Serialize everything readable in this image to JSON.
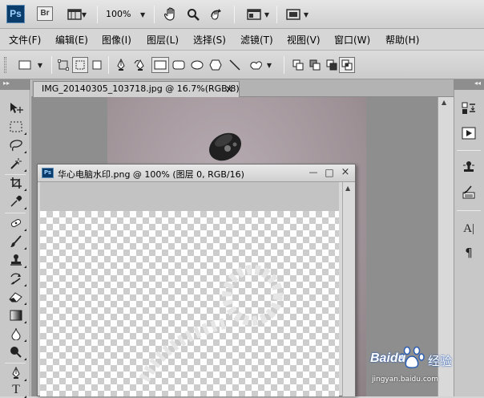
{
  "appbar": {
    "ps_logo": "Ps",
    "br_logo": "Br",
    "zoom": "100%",
    "icons": [
      "view-extras-icon",
      "zoom-level-dropdown",
      "hand-tool-icon",
      "zoom-tool-icon",
      "rotate-view-icon",
      "arrange-documents-icon",
      "screen-mode-icon"
    ]
  },
  "menu": {
    "items": [
      "文件(F)",
      "编辑(E)",
      "图像(I)",
      "图层(L)",
      "选择(S)",
      "滤镜(T)",
      "视图(V)",
      "窗口(W)",
      "帮助(H)"
    ]
  },
  "main_doc": {
    "tab_title": "IMG_20140305_103718.jpg @ 16.7%(RGB/8)",
    "close": "×"
  },
  "float_doc": {
    "title": "华心电脑水印.png @ 100% (图层 0, RGB/16)",
    "minimize": "—",
    "maximize": "□",
    "close": "×"
  },
  "right_panel": {
    "paragraph_glyph": "¶",
    "char_glyph": "A|"
  },
  "watermark": {
    "brand": "Baidu",
    "suffix": "经验",
    "url": "jingyan.baidu.com"
  },
  "colors": {
    "photoshop_blue": "#0b3d6c",
    "baidu_blue": "#2b5db3"
  }
}
